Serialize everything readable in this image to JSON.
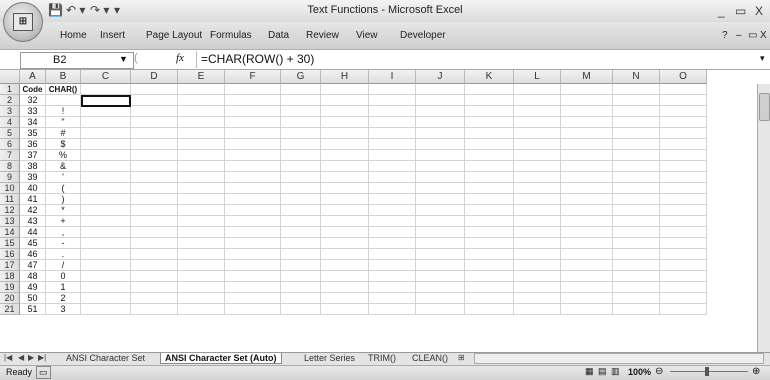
{
  "window": {
    "title": "Text Functions - Microsoft Excel",
    "controls": [
      "_",
      "▭",
      "X"
    ],
    "ribbon_controls": [
      "?",
      "–",
      "▭",
      "X"
    ]
  },
  "quick_access": [
    "💾",
    "↶ ▾",
    "↷ ▾",
    "▾"
  ],
  "ribbon_tabs": [
    "Home",
    "Insert",
    "Page Layout",
    "Formulas",
    "Data",
    "Review",
    "View",
    "Developer"
  ],
  "formula_bar": {
    "name_box": "B2",
    "fx_label": "fx",
    "formula": "=CHAR(ROW() + 30)"
  },
  "columns": [
    "A",
    "B",
    "C",
    "D",
    "E",
    "F",
    "G",
    "H",
    "I",
    "J",
    "K",
    "L",
    "M",
    "N",
    "O"
  ],
  "header_row": {
    "a": "Code",
    "b": "CHAR()"
  },
  "rows": [
    {
      "n": "1"
    },
    {
      "n": "2",
      "a": "32",
      "b": " "
    },
    {
      "n": "3",
      "a": "33",
      "b": "!"
    },
    {
      "n": "4",
      "a": "34",
      "b": "\""
    },
    {
      "n": "5",
      "a": "35",
      "b": "#"
    },
    {
      "n": "6",
      "a": "36",
      "b": "$"
    },
    {
      "n": "7",
      "a": "37",
      "b": "%"
    },
    {
      "n": "8",
      "a": "38",
      "b": "&"
    },
    {
      "n": "9",
      "a": "39",
      "b": "'"
    },
    {
      "n": "10",
      "a": "40",
      "b": "("
    },
    {
      "n": "11",
      "a": "41",
      "b": ")"
    },
    {
      "n": "12",
      "a": "42",
      "b": "*"
    },
    {
      "n": "13",
      "a": "43",
      "b": "+"
    },
    {
      "n": "14",
      "a": "44",
      "b": ","
    },
    {
      "n": "15",
      "a": "45",
      "b": "-"
    },
    {
      "n": "16",
      "a": "46",
      "b": "."
    },
    {
      "n": "17",
      "a": "47",
      "b": "/"
    },
    {
      "n": "18",
      "a": "48",
      "b": "0"
    },
    {
      "n": "19",
      "a": "49",
      "b": "1"
    },
    {
      "n": "20",
      "a": "50",
      "b": "2"
    },
    {
      "n": "21",
      "a": "51",
      "b": "3"
    }
  ],
  "sheet_tabs": [
    "ANSI Character Set",
    "ANSI Character Set (Auto)",
    "Letter Series",
    "TRIM()",
    "CLEAN()"
  ],
  "active_sheet": "ANSI Character Set (Auto)",
  "status": {
    "ready": "Ready",
    "zoom": "100%"
  }
}
